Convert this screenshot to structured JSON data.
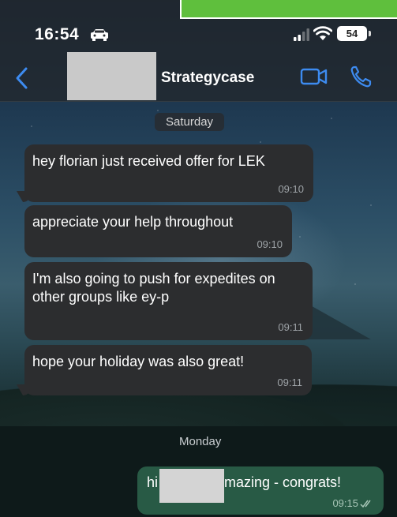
{
  "status_bar": {
    "time": "16:54",
    "battery": "54"
  },
  "header": {
    "contact_name": "Strategycase"
  },
  "chat": {
    "day_1": "Saturday",
    "day_2": "Monday",
    "messages": [
      {
        "text": "hey florian just received offer for LEK",
        "time": "09:10"
      },
      {
        "text": "appreciate your help throughout",
        "time": "09:10"
      },
      {
        "text": "I'm also going to push for expedites on other groups like ey-p",
        "time": "09:11"
      },
      {
        "text": "hope your holiday was also great!",
        "time": "09:11"
      }
    ],
    "outgoing": {
      "text_start": "hi",
      "text_end": "mazing - congrats!",
      "time": "09:15"
    }
  },
  "colors": {
    "incoming_bubble": "#2c2d2f",
    "outgoing_bubble": "#285a45",
    "accent": "#3d8bf0",
    "top_mark": "#5fbf3d"
  }
}
